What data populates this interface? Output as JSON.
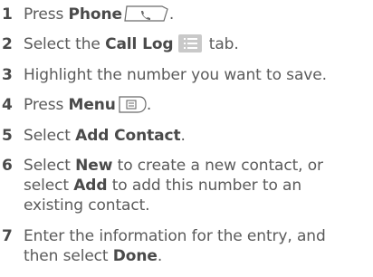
{
  "steps": [
    {
      "number": "1",
      "pre": "Press ",
      "bold": "Phone",
      "post": ".",
      "icon": "phone-key-icon"
    },
    {
      "number": "2",
      "pre": "Select the ",
      "bold": "Call Log",
      "post": " tab.",
      "icon": "call-log-tab-icon"
    },
    {
      "number": "3",
      "text": "Highlight the number you want to save."
    },
    {
      "number": "4",
      "pre": "Press ",
      "bold": "Menu",
      "post": ".",
      "icon": "menu-key-icon"
    },
    {
      "number": "5",
      "pre": "Select ",
      "bold": "Add Contact",
      "post": "."
    },
    {
      "number": "6",
      "line1_pre": "Select ",
      "line1_bold": "New",
      "line1_post": " to create a new contact, or",
      "line2_pre": "select ",
      "line2_bold": "Add",
      "line2_post": " to add this number to an",
      "line3": "existing contact."
    },
    {
      "number": "7",
      "line1": "Enter the information for the entry, and",
      "line2_pre": "then select ",
      "line2_bold": "Done",
      "line2_post": "."
    }
  ],
  "colors": {
    "text": "#5a5a5a",
    "bold_text": "#4a4a4a",
    "tab_icon_bg": "#c9c9c9"
  }
}
